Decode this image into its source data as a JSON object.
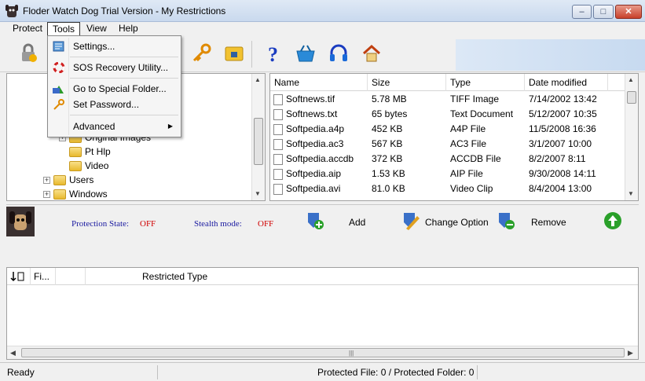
{
  "window": {
    "title": "Floder Watch Dog Trial Version - My Restrictions",
    "min_label": "–",
    "max_label": "□",
    "close_label": "✕"
  },
  "menu": {
    "protect": "Protect",
    "tools": "Tools",
    "view": "View",
    "help": "Help"
  },
  "tools_menu": {
    "settings": "Settings...",
    "sos": "SOS Recovery Utility...",
    "goto": "Go to Special Folder...",
    "password": "Set Password...",
    "advanced": "Advanced",
    "advanced_arrow": "▶"
  },
  "tree": {
    "items": [
      {
        "label": "Original Images",
        "expand": "+"
      },
      {
        "label": "Pt Hlp",
        "expand": ""
      },
      {
        "label": "Video",
        "expand": ""
      },
      {
        "label": "Users",
        "expand": "+"
      },
      {
        "label": "Windows",
        "expand": "+"
      }
    ]
  },
  "files": {
    "headers": {
      "name": "Name",
      "size": "Size",
      "type": "Type",
      "modified": "Date modified"
    },
    "rows": [
      {
        "name": "Softnews.tif",
        "size": "5.78 MB",
        "type": "TIFF Image",
        "modified": "7/14/2002 13:42"
      },
      {
        "name": "Softnews.txt",
        "size": "65 bytes",
        "type": "Text Document",
        "modified": "5/12/2007 10:35"
      },
      {
        "name": "Softpedia.a4p",
        "size": "452 KB",
        "type": "A4P File",
        "modified": "11/5/2008 16:36"
      },
      {
        "name": "Softpedia.ac3",
        "size": "567 KB",
        "type": "AC3 File",
        "modified": "3/1/2007 10:00"
      },
      {
        "name": "Softpedia.accdb",
        "size": "372 KB",
        "type": "ACCDB File",
        "modified": "8/2/2007 8:11"
      },
      {
        "name": "Softpedia.aip",
        "size": "1.53 KB",
        "type": "AIP File",
        "modified": "9/30/2008 14:11"
      },
      {
        "name": "Softpedia.avi",
        "size": "81.0 KB",
        "type": "Video Clip",
        "modified": "8/4/2004 13:00"
      }
    ]
  },
  "protection": {
    "state_label": "Protection State:",
    "state_value": "OFF",
    "stealth_label": "Stealth mode:",
    "stealth_value": "OFF",
    "add": "Add",
    "change": "Change Option",
    "remove": "Remove"
  },
  "restrictions": {
    "col_file": "Fi...",
    "col_type": "Restricted Type"
  },
  "status": {
    "ready": "Ready",
    "protected": "Protected File: 0 / Protected Folder: 0"
  },
  "colors": {
    "label_blue": "#1a1aa0",
    "value_red": "#d00000"
  }
}
